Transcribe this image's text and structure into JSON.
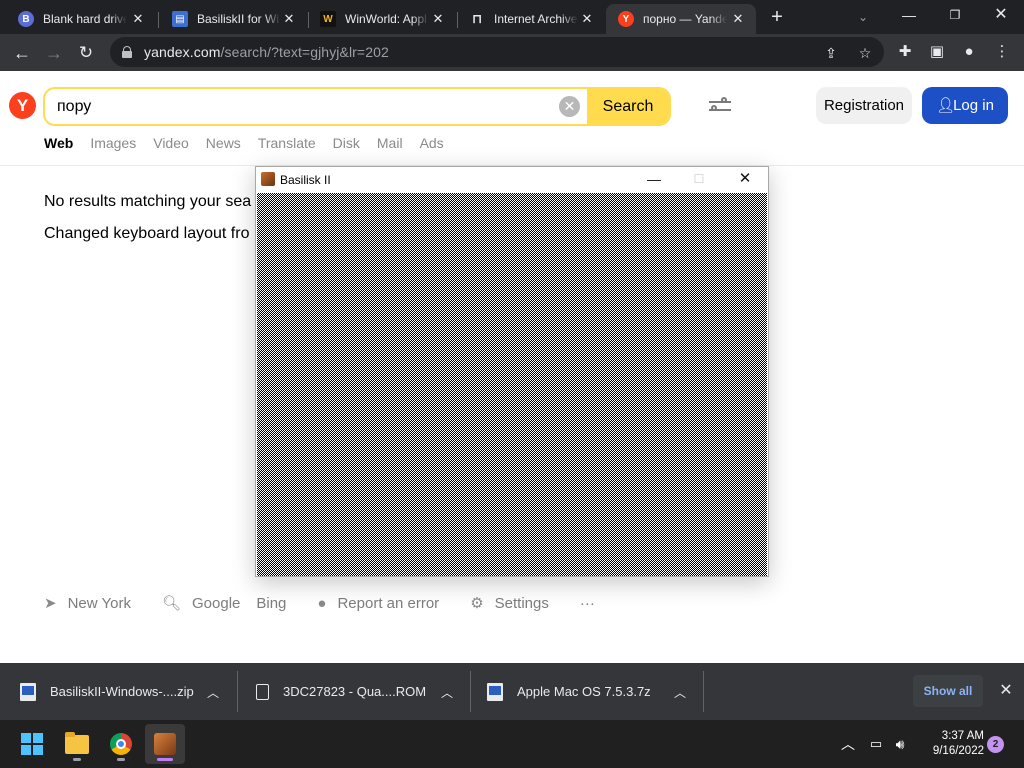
{
  "browser": {
    "tabs": [
      {
        "title": "Blank hard drive",
        "favicon": "blank-favicon",
        "color": "#5b6dd6",
        "letter": "B"
      },
      {
        "title": "BasiliskII for Wi",
        "favicon": "doc-favicon",
        "color": "#3d6fd1",
        "letter": "▤"
      },
      {
        "title": "WinWorld: Appl",
        "favicon": "winworld-favicon",
        "color": "#111111",
        "letter": "W"
      },
      {
        "title": "Internet Archive",
        "favicon": "archive-favicon",
        "color": "#202124",
        "letter": "⊓"
      },
      {
        "title": "порно — Yande",
        "favicon": "yandex-favicon",
        "color": "#fc3f1d",
        "letter": "Y"
      }
    ],
    "new_tab_label": "+",
    "url_host": "yandex.com",
    "url_rest": "/search/?text=gjhyj&lr=202"
  },
  "yandex": {
    "logo_letter": "Y",
    "query": "пору",
    "search_label": "Search",
    "registration_label": "Registration",
    "login_label": "Log in",
    "nav_tabs": [
      "Web",
      "Images",
      "Video",
      "News",
      "Translate",
      "Disk",
      "Mail",
      "Ads"
    ],
    "message_1": "No results matching your sea",
    "message_2": "Changed keyboard layout fro",
    "footer": {
      "location": "New York",
      "google": "Google",
      "bing": "Bing",
      "report": "Report an error",
      "settings": "Settings",
      "more": "···"
    }
  },
  "basilisk": {
    "title": "Basilisk II"
  },
  "downloads": {
    "items": [
      {
        "name": "BasiliskII-Windows-....zip"
      },
      {
        "name": "3DC27823 - Qua....ROM"
      },
      {
        "name": "Apple Mac OS 7.5.3.7z"
      }
    ],
    "show_all": "Show all"
  },
  "taskbar": {
    "time": "3:37 AM",
    "date": "9/16/2022",
    "notifications": "2"
  },
  "colors": {
    "yandex_yellow": "#ffdb4d",
    "yandex_red": "#fc3f1d",
    "login_blue": "#1d4fc7"
  }
}
